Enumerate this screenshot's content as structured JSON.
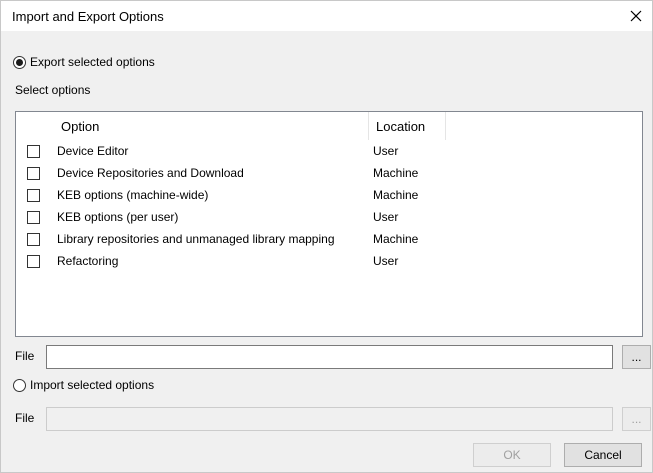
{
  "dialog": {
    "title": "Import and Export Options",
    "close_glyph": "✕"
  },
  "export": {
    "label": "Export selected options",
    "checked": true,
    "select_options_label": "Select options",
    "columns": {
      "option": "Option",
      "location": "Location"
    },
    "rows": [
      {
        "option": "Device Editor",
        "location": "User"
      },
      {
        "option": "Device Repositories and Download",
        "location": "Machine"
      },
      {
        "option": "KEB options (machine-wide)",
        "location": "Machine"
      },
      {
        "option": "KEB options (per user)",
        "location": "User"
      },
      {
        "option": "Library repositories and unmanaged library mapping",
        "location": "Machine"
      },
      {
        "option": "Refactoring",
        "location": "User"
      }
    ],
    "file_label": "File",
    "file_value": "",
    "browse_label": "..."
  },
  "import": {
    "label": "Import selected options",
    "checked": false,
    "file_label": "File",
    "file_value": "",
    "browse_label": "..."
  },
  "buttons": {
    "ok": "OK",
    "cancel": "Cancel"
  },
  "icons": {
    "close": "close-icon",
    "radio_export": "radio-button-icon",
    "radio_import": "radio-button-icon"
  }
}
